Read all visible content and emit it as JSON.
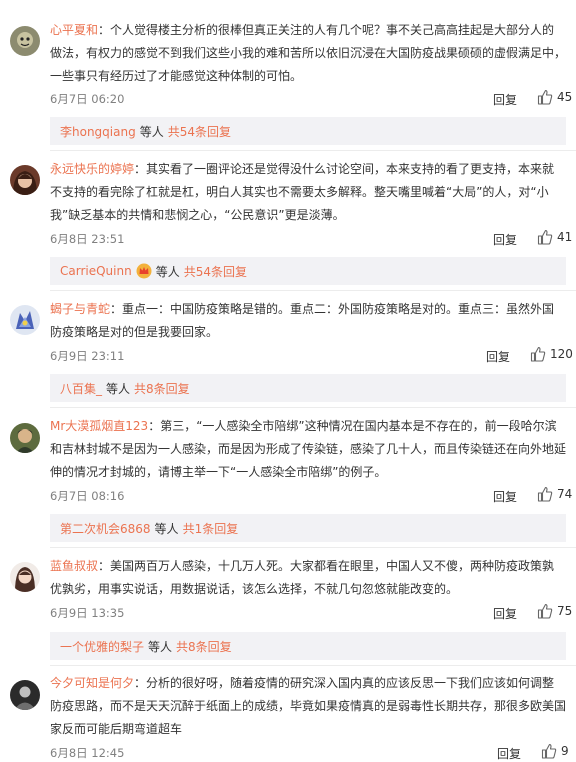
{
  "comments": [
    {
      "user": "心平夏和",
      "text": "个人觉得楼主分析的很棒但真正关注的人有几个呢？事不关己高高挂起是大部分人的做法，有权力的感觉不到我们这些小我的难和苦所以依旧沉浸在大国防疫战果硕硕的虚假满足中，一些事只有经历过了才能感觉这种体制的可怕。",
      "time": "6月7日 06:20",
      "reply": "回复",
      "likes": "45",
      "sub": {
        "name": "李hongqiang",
        "etc": "等人",
        "total": "共54条回复"
      }
    },
    {
      "user": "永远快乐的婷婷",
      "text": "其实看了一圈评论还是觉得没什么讨论空间，本来支持的看了更支持，本来就不支持的看完除了杠就是杠，明白人其实也不需要太多解释。整天嘴里喊着“大局”的人，对“小我”缺乏基本的共情和悲悯之心，“公民意识”更是淡薄。",
      "time": "6月8日 23:51",
      "reply": "回复",
      "likes": "41",
      "sub": {
        "name": "CarrieQuinn",
        "etc": "等人",
        "total": "共54条回复"
      }
    },
    {
      "user": "蝎子与青蛇",
      "text": "重点一：中国防疫策略是错的。重点二：外国防疫策略是对的。重点三：虽然外国防疫策略是对的但是我要回家。",
      "time": "6月9日 23:11",
      "reply": "回复",
      "likes": "120",
      "sub": {
        "name": "八百集_",
        "etc": "等人",
        "total": "共8条回复"
      }
    },
    {
      "user": "Mr大漠孤烟直123",
      "text": "第三，“一人感染全市陪绑”这种情况在国内基本是不存在的，前一段哈尔滨和吉林封城不是因为一人感染，而是因为形成了传染链，感染了几十人，而且传染链还在向外地延伸的情况才封城的，请博主举一下“一人感染全市陪绑”的例子。",
      "time": "6月7日 08:16",
      "reply": "回复",
      "likes": "74",
      "sub": {
        "name": "第二次机会6868",
        "etc": "等人",
        "total": "共1条回复"
      }
    },
    {
      "user": "蓝鱼叔叔",
      "text": "美国两百万人感染，十几万人死。大家都看在眼里，中国人又不傻，两种防疫政策孰优孰劣，用事实说话，用数据说话，该怎么选择，不就几句忽悠就能改变的。",
      "time": "6月9日 13:35",
      "reply": "回复",
      "likes": "75",
      "sub": {
        "name": "一个优雅的梨子",
        "etc": "等人",
        "total": "共8条回复"
      }
    },
    {
      "user": "今夕可知是何夕",
      "text": "分析的很好呀，随着疫情的研究深入国内真的应该反思一下我们应该如何调整防疫思路，而不是天天沉醉于纸面上的成绩，毕竟如果疫情真的是弱毒性长期共存，那很多欧美国家反而可能后期弯道超车",
      "time": "6月8日 12:45",
      "reply": "回复",
      "likes": "9"
    }
  ],
  "colors": {
    "name": "#eb7350",
    "text": "#333333",
    "time": "#808080",
    "sub_bg": "#f2f2f5"
  },
  "icons": {
    "like": "thumbs-up-icon",
    "badge": "crown-badge-icon"
  }
}
